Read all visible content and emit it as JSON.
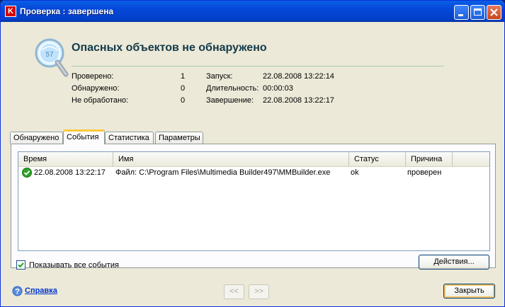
{
  "window": {
    "title": "Проверка : завершена",
    "app_icon_letter": "K"
  },
  "header": {
    "title": "Опасных объектов не обнаружено",
    "icon_badge": "57"
  },
  "summary": {
    "scanned_label": "Проверено:",
    "scanned_value": "1",
    "detected_label": "Обнаружено:",
    "detected_value": "0",
    "unprocessed_label": "Не обработано:",
    "unprocessed_value": "0",
    "start_label": "Запуск:",
    "start_value": "22.08.2008 13:22:14",
    "duration_label": "Длительность:",
    "duration_value": "00:00:03",
    "end_label": "Завершение:",
    "end_value": "22.08.2008 13:22:17"
  },
  "tabs": [
    {
      "label": "Обнаружено",
      "active": false
    },
    {
      "label": "События",
      "active": true
    },
    {
      "label": "Статистика",
      "active": false
    },
    {
      "label": "Параметры",
      "active": false
    }
  ],
  "events_table": {
    "columns": [
      "Время",
      "Имя",
      "Статус",
      "Причина"
    ],
    "rows": [
      {
        "time": "22.08.2008 13:22:17",
        "name": "Файл: C:\\Program Files\\Multimedia Builder497\\MMBuilder.exe",
        "status": "ok",
        "reason": "проверен"
      }
    ]
  },
  "show_all_events": {
    "label": "Показывать все события",
    "checked": true
  },
  "buttons": {
    "actions": "Действия...",
    "prev": "<<",
    "next": ">>",
    "close": "Закрыть"
  },
  "help": {
    "label": "Справка"
  },
  "colors": {
    "titlebar": "#0447d8",
    "header_title": "#123a4a",
    "link": "#0033cc",
    "ok_icon": "#2fa32b"
  }
}
